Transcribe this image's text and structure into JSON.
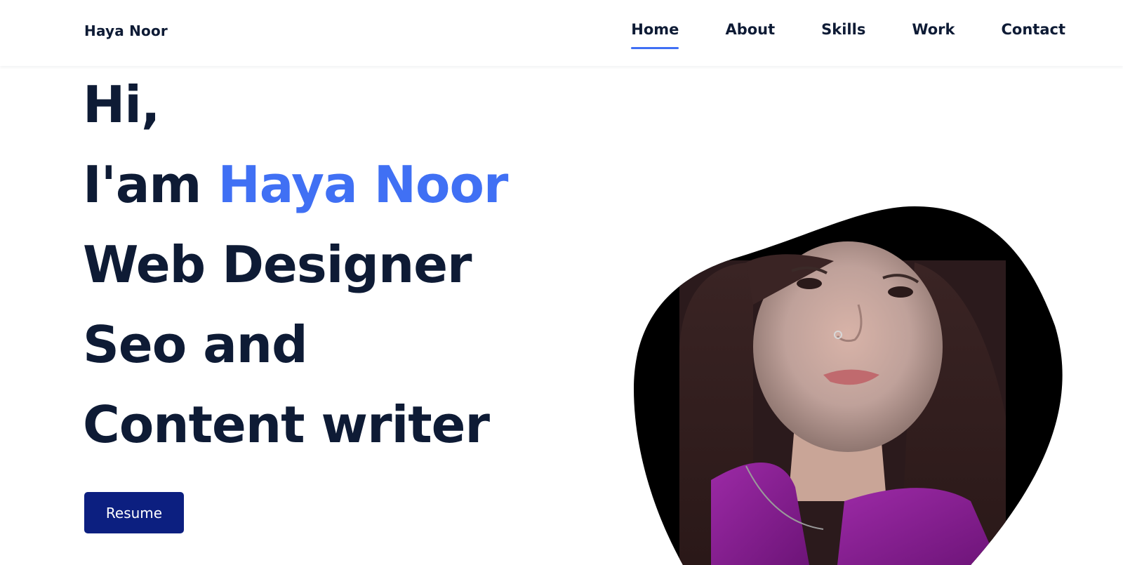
{
  "header": {
    "logo": "Haya Noor",
    "nav": [
      {
        "label": "Home",
        "active": true
      },
      {
        "label": "About",
        "active": false
      },
      {
        "label": "Skills",
        "active": false
      },
      {
        "label": "Work",
        "active": false
      },
      {
        "label": "Contact",
        "active": false
      }
    ]
  },
  "hero": {
    "line1": "Hi,",
    "line2_prefix": "I'am ",
    "line2_name": "Haya Noor",
    "line3": "Web Designer",
    "line4": "Seo and",
    "line5": "Content writer",
    "resume_button": "Resume"
  },
  "colors": {
    "text": "#0e1b35",
    "accent": "#4070f4",
    "button": "#0c1f80",
    "blob": "#000000"
  },
  "icons": {
    "portrait": "portrait-photo"
  }
}
